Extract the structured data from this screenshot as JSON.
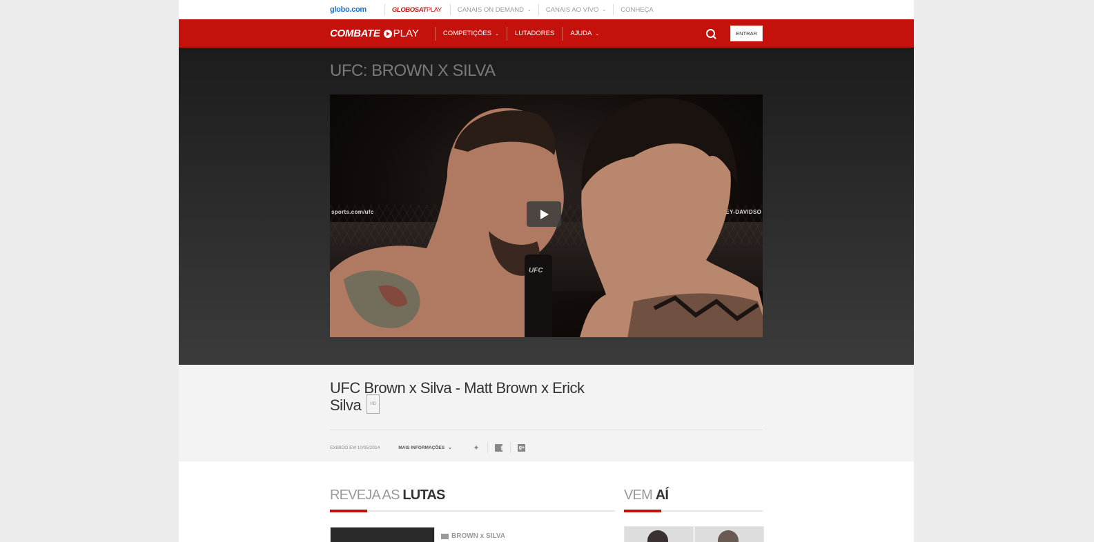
{
  "globo_bar": {
    "logo": "globo.com",
    "gsplay_brand": "GLOBOSAT",
    "gsplay_suffix": "PLAY",
    "items": [
      {
        "label": "CANAIS ON DEMAND"
      },
      {
        "label": "CANAIS AO VIVO"
      },
      {
        "label": "CONHEÇA"
      }
    ]
  },
  "nav": {
    "brand_combate": "COMBATE",
    "brand_play": "PLAY",
    "items": [
      {
        "label": "COMPETIÇÕES"
      },
      {
        "label": "LUTADORES"
      },
      {
        "label": "AJUDA"
      }
    ],
    "login_label": "ENTRAR"
  },
  "hero": {
    "page_title": "UFC: BROWN X SILVA",
    "video_banner_left": "sports.com/ufc",
    "video_banner_right": "HARLEY-DAVIDSO",
    "mic_text": "UFC"
  },
  "info": {
    "title": "UFC Brown x Silva - Matt Brown x Erick Silva",
    "badge": "HD",
    "aired": "EXIBIDO EM 10/05/2014",
    "more_info": "MAIS INFORMAÇÕES"
  },
  "sections": {
    "reveja_light": "REVEJA AS ",
    "reveja_bold": "LUTAS",
    "vem_light": "VEM ",
    "vem_bold": "AÍ",
    "first_row_label": "BROWN x SILVA"
  },
  "colors": {
    "brand_red": "#c4110b",
    "globo_blue": "#1f6fd1"
  },
  "icons": [
    "search-icon",
    "twitter-icon",
    "facebook-icon",
    "google-plus-icon",
    "play-icon",
    "chevron-down-icon"
  ]
}
